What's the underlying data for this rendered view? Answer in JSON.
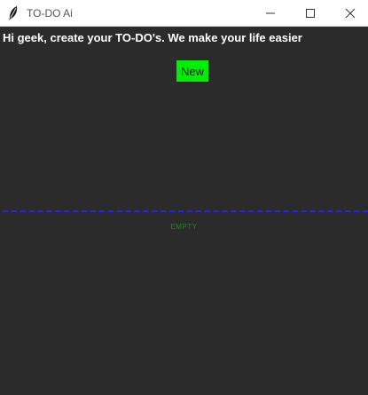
{
  "window": {
    "title": "TO-DO Ai",
    "icon": "feather-icon"
  },
  "controls": {
    "minimize_icon": "minimize-icon",
    "maximize_icon": "maximize-icon",
    "close_icon": "close-icon"
  },
  "main": {
    "heading": "Hi geek, create your TO-DO's. We make your life easier",
    "new_button_label": "New",
    "empty_label": "EMPTY"
  },
  "colors": {
    "background": "#2b2b2b",
    "new_button": "#00ee00",
    "divider": "#2222ff",
    "empty_text": "#1f8a1f"
  }
}
